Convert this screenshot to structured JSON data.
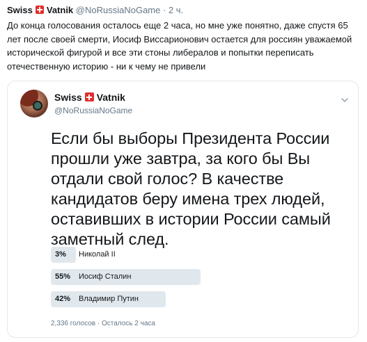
{
  "tweet": {
    "author_name": "Swiss",
    "author_name_suffix": "Vatnik",
    "handle": "@NoRussiaNoGame",
    "separator": "·",
    "time": "2 ч.",
    "text": "До конца голосования осталось еще 2 часа, но мне уже понятно, даже спустя 65 лет после своей смерти, Иосиф Виссарионович остается для россиян уважаемой исторической фигурой и все эти стоны либералов и попытки переписать отечественную историю - ни к чему не привели"
  },
  "quoted_tweet": {
    "author_name": "Swiss",
    "author_name_suffix": "Vatnik",
    "handle": "@NoRussiaNoGame",
    "poll": {
      "question": "Если бы выборы Президента России прошли уже завтра, за кого бы Вы отдали свой голос? В качестве кандидатов беру имена трех людей, оставивших в истории России самый заметный след.",
      "options": [
        {
          "percent_label": "3%",
          "percent": 3,
          "label": "Николай II"
        },
        {
          "percent_label": "55%",
          "percent": 55,
          "label": "Иосиф Сталин"
        },
        {
          "percent_label": "42%",
          "percent": 42,
          "label": "Владимир Путин"
        }
      ],
      "votes": "2,336 голосов",
      "separator": "·",
      "remaining": "Осталось 2 часа"
    }
  },
  "icons": {
    "flag": "swiss-flag-icon",
    "caret": "chevron-down-icon"
  },
  "colors": {
    "flag_red": "#e0302d",
    "secondary_text": "#657786",
    "poll_bar": "#e1e8ed",
    "border": "#e1e8ed"
  }
}
